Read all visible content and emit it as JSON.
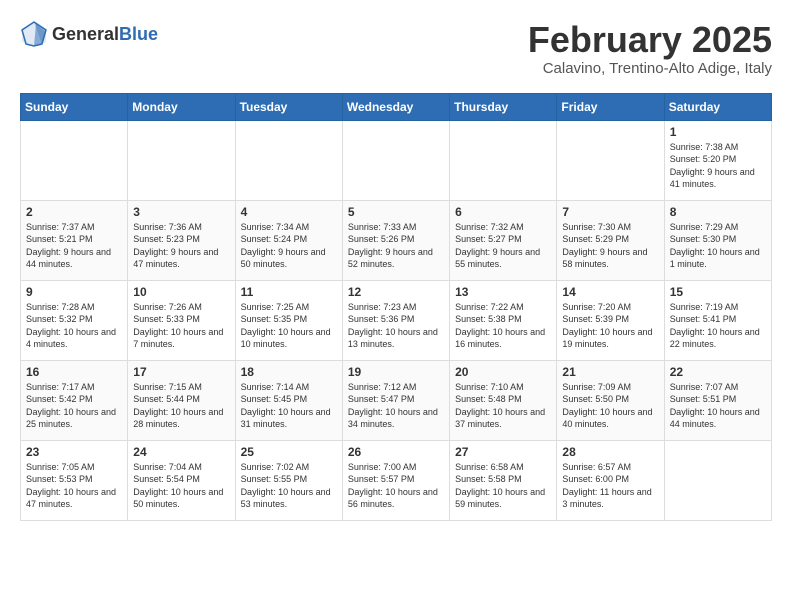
{
  "logo": {
    "general": "General",
    "blue": "Blue"
  },
  "header": {
    "month": "February 2025",
    "location": "Calavino, Trentino-Alto Adige, Italy"
  },
  "weekdays": [
    "Sunday",
    "Monday",
    "Tuesday",
    "Wednesday",
    "Thursday",
    "Friday",
    "Saturday"
  ],
  "weeks": [
    [
      {
        "day": "",
        "info": ""
      },
      {
        "day": "",
        "info": ""
      },
      {
        "day": "",
        "info": ""
      },
      {
        "day": "",
        "info": ""
      },
      {
        "day": "",
        "info": ""
      },
      {
        "day": "",
        "info": ""
      },
      {
        "day": "1",
        "info": "Sunrise: 7:38 AM\nSunset: 5:20 PM\nDaylight: 9 hours and 41 minutes."
      }
    ],
    [
      {
        "day": "2",
        "info": "Sunrise: 7:37 AM\nSunset: 5:21 PM\nDaylight: 9 hours and 44 minutes."
      },
      {
        "day": "3",
        "info": "Sunrise: 7:36 AM\nSunset: 5:23 PM\nDaylight: 9 hours and 47 minutes."
      },
      {
        "day": "4",
        "info": "Sunrise: 7:34 AM\nSunset: 5:24 PM\nDaylight: 9 hours and 50 minutes."
      },
      {
        "day": "5",
        "info": "Sunrise: 7:33 AM\nSunset: 5:26 PM\nDaylight: 9 hours and 52 minutes."
      },
      {
        "day": "6",
        "info": "Sunrise: 7:32 AM\nSunset: 5:27 PM\nDaylight: 9 hours and 55 minutes."
      },
      {
        "day": "7",
        "info": "Sunrise: 7:30 AM\nSunset: 5:29 PM\nDaylight: 9 hours and 58 minutes."
      },
      {
        "day": "8",
        "info": "Sunrise: 7:29 AM\nSunset: 5:30 PM\nDaylight: 10 hours and 1 minute."
      }
    ],
    [
      {
        "day": "9",
        "info": "Sunrise: 7:28 AM\nSunset: 5:32 PM\nDaylight: 10 hours and 4 minutes."
      },
      {
        "day": "10",
        "info": "Sunrise: 7:26 AM\nSunset: 5:33 PM\nDaylight: 10 hours and 7 minutes."
      },
      {
        "day": "11",
        "info": "Sunrise: 7:25 AM\nSunset: 5:35 PM\nDaylight: 10 hours and 10 minutes."
      },
      {
        "day": "12",
        "info": "Sunrise: 7:23 AM\nSunset: 5:36 PM\nDaylight: 10 hours and 13 minutes."
      },
      {
        "day": "13",
        "info": "Sunrise: 7:22 AM\nSunset: 5:38 PM\nDaylight: 10 hours and 16 minutes."
      },
      {
        "day": "14",
        "info": "Sunrise: 7:20 AM\nSunset: 5:39 PM\nDaylight: 10 hours and 19 minutes."
      },
      {
        "day": "15",
        "info": "Sunrise: 7:19 AM\nSunset: 5:41 PM\nDaylight: 10 hours and 22 minutes."
      }
    ],
    [
      {
        "day": "16",
        "info": "Sunrise: 7:17 AM\nSunset: 5:42 PM\nDaylight: 10 hours and 25 minutes."
      },
      {
        "day": "17",
        "info": "Sunrise: 7:15 AM\nSunset: 5:44 PM\nDaylight: 10 hours and 28 minutes."
      },
      {
        "day": "18",
        "info": "Sunrise: 7:14 AM\nSunset: 5:45 PM\nDaylight: 10 hours and 31 minutes."
      },
      {
        "day": "19",
        "info": "Sunrise: 7:12 AM\nSunset: 5:47 PM\nDaylight: 10 hours and 34 minutes."
      },
      {
        "day": "20",
        "info": "Sunrise: 7:10 AM\nSunset: 5:48 PM\nDaylight: 10 hours and 37 minutes."
      },
      {
        "day": "21",
        "info": "Sunrise: 7:09 AM\nSunset: 5:50 PM\nDaylight: 10 hours and 40 minutes."
      },
      {
        "day": "22",
        "info": "Sunrise: 7:07 AM\nSunset: 5:51 PM\nDaylight: 10 hours and 44 minutes."
      }
    ],
    [
      {
        "day": "23",
        "info": "Sunrise: 7:05 AM\nSunset: 5:53 PM\nDaylight: 10 hours and 47 minutes."
      },
      {
        "day": "24",
        "info": "Sunrise: 7:04 AM\nSunset: 5:54 PM\nDaylight: 10 hours and 50 minutes."
      },
      {
        "day": "25",
        "info": "Sunrise: 7:02 AM\nSunset: 5:55 PM\nDaylight: 10 hours and 53 minutes."
      },
      {
        "day": "26",
        "info": "Sunrise: 7:00 AM\nSunset: 5:57 PM\nDaylight: 10 hours and 56 minutes."
      },
      {
        "day": "27",
        "info": "Sunrise: 6:58 AM\nSunset: 5:58 PM\nDaylight: 10 hours and 59 minutes."
      },
      {
        "day": "28",
        "info": "Sunrise: 6:57 AM\nSunset: 6:00 PM\nDaylight: 11 hours and 3 minutes."
      },
      {
        "day": "",
        "info": ""
      }
    ]
  ]
}
